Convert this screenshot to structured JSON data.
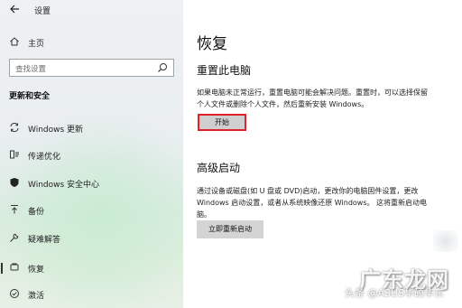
{
  "window": {
    "title": "设置"
  },
  "sidebar": {
    "home_label": "主页",
    "search_placeholder": "查找设置",
    "section_title": "更新和安全",
    "items": [
      {
        "label": "Windows 更新",
        "icon": "sync-icon"
      },
      {
        "label": "传递优化",
        "icon": "delivery-optimization-icon"
      },
      {
        "label": "Windows 安全中心",
        "icon": "shield-icon"
      },
      {
        "label": "备份",
        "icon": "backup-arrow-icon"
      },
      {
        "label": "疑难解答",
        "icon": "wrench-icon"
      },
      {
        "label": "恢复",
        "icon": "recovery-icon",
        "selected": true
      },
      {
        "label": "激活",
        "icon": "check-circle-icon"
      }
    ]
  },
  "main": {
    "title": "恢复",
    "reset": {
      "heading": "重置此电脑",
      "description_line1": "如果电脑未正常运行，重置电脑可能会解决问题。重置时，可以选择保留",
      "description_line2": "个人文件或删除个人文件，然后重新安装 Windows。",
      "button": "开始"
    },
    "advanced": {
      "heading": "高级启动",
      "description_line1": "通过设备或磁盘(如 U 盘或 DVD)启动，更改你的电脑固件设置，更改",
      "description_line2": "Windows 启动设置，或者从系统映像还原 Windows。 这将重新启动电",
      "description_line3": "脑。",
      "button": "立即重新启动"
    }
  },
  "watermark": {
    "site": "广东龙网",
    "source": "头条 @ASUS华硕华东"
  },
  "colors": {
    "highlight_border": "#e0222a",
    "button_bg": "#cfcfcf"
  }
}
